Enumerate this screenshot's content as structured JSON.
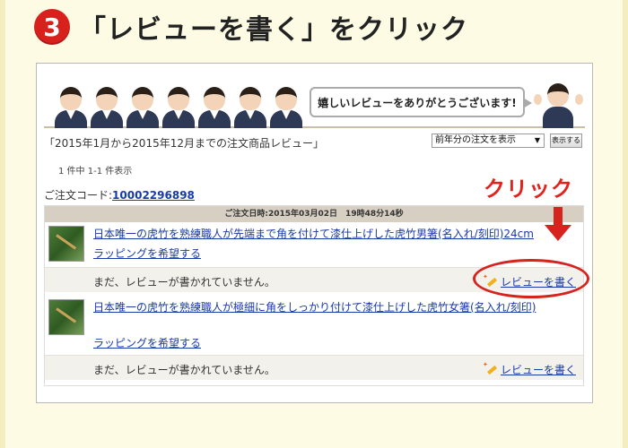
{
  "heading": {
    "step_number": "3",
    "title": "「レビューを書く」をクリック"
  },
  "banner": {
    "message": "嬉しいレビューをありがとうございます!"
  },
  "filter": {
    "period_label": "「2015年1月から2015年12月までの注文商品レビュー」",
    "select_value": "前年分の注文を表示",
    "show_button": "表示する"
  },
  "results": {
    "count": "1 件中 1-1 件表示"
  },
  "callout": {
    "click_text": "クリック"
  },
  "order": {
    "code_label": "ご注文コード:",
    "code_value": "10002296898",
    "date_line": "ご注文日時:2015年03月02日　19時48分14秒",
    "items": [
      {
        "title": "日本唯一の虎竹を熟練職人が先端まで角を付けて漆仕上げした虎竹男箸(名入れ/刻印)24cm",
        "wrap_link": "ラッピングを希望する",
        "status": "まだ、レビューが書かれていません。",
        "review_link": "レビューを書く"
      },
      {
        "title": "日本唯一の虎竹を熟練職人が極細に角をしっかり付けて漆仕上げした虎竹女箸(名入れ/刻印)",
        "wrap_link": "ラッピングを希望する",
        "status": "まだ、レビューが書かれていません。",
        "review_link": "レビューを書く"
      }
    ]
  },
  "colors": {
    "accent_red": "#d8201c",
    "link_blue": "#1a3aa8",
    "background": "#fdfbe4"
  }
}
